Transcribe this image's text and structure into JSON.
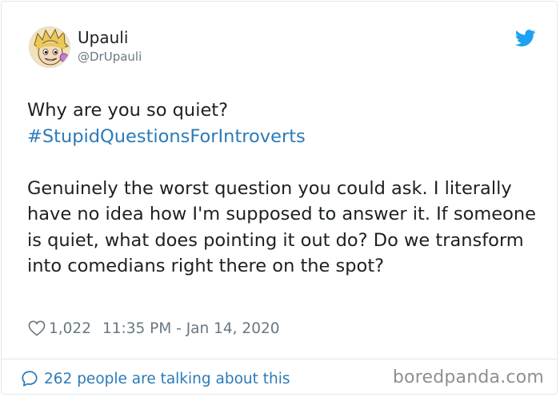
{
  "author": {
    "display_name": "Upauli",
    "handle": "@DrUpauli"
  },
  "tweet": {
    "line1": "Why are you so quiet?",
    "hashtag": "#StupidQuestionsForIntroverts",
    "body": "Genuinely the worst question you could ask. I literally have no idea how I'm supposed to answer it. If someone is quiet, what does pointing it out do? Do we transform into comedians right there on the spot?"
  },
  "meta": {
    "likes": "1,022",
    "timestamp": "11:35 PM - Jan 14, 2020"
  },
  "footer": {
    "talking": "262 people are talking about this",
    "watermark": "boredpanda.com"
  },
  "icons": {
    "brand": "twitter-bird-icon",
    "like": "heart-icon",
    "comment": "speech-bubble-icon"
  },
  "colors": {
    "link": "#2b7bb9",
    "twitter_blue": "#1da1f2",
    "muted": "#697882",
    "text": "#1c2022"
  }
}
